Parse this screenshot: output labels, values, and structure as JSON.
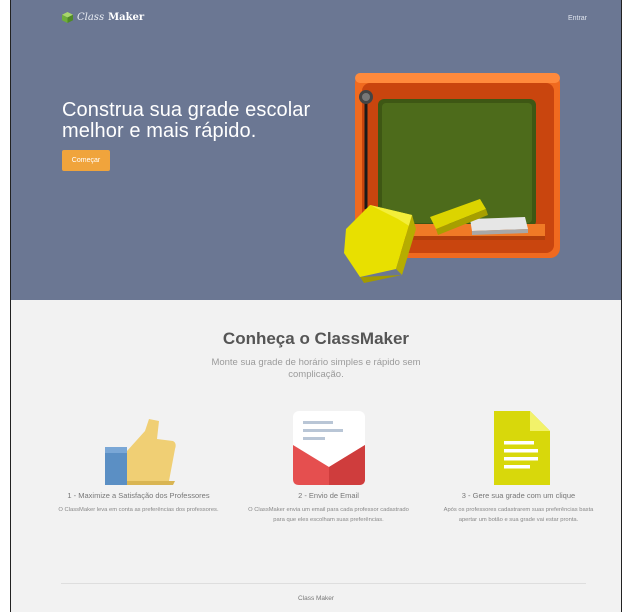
{
  "nav": {
    "brand_italic": "Class",
    "brand_bold": "Maker",
    "login_label": "Entrar"
  },
  "hero": {
    "title": "Construa sua grade escolar melhor e mais rápido.",
    "cta_label": "Começar"
  },
  "intro": {
    "title": "Conheça o ClassMaker",
    "subtitle": "Monte sua grade de horário simples e rápido sem complicação."
  },
  "features": [
    {
      "icon": "thumbs-up-icon",
      "title": "1 - Maximize a Satisfação dos Professores",
      "text": "O ClassMaker leva em conta as preferências dos professores."
    },
    {
      "icon": "envelope-icon",
      "title": "2 - Envio de Email",
      "text": "O ClassMaker envia um email para cada professor cadastrado para que eles escolham suas preferências."
    },
    {
      "icon": "document-icon",
      "title": "3 - Gere sua grade com um clique",
      "text": "Após os professores cadastrarem suas preferências basta apertar um botão e sua grade vai estar pronta."
    }
  ],
  "footer": {
    "text": "Class Maker"
  },
  "colors": {
    "hero_bg": "#6b7793",
    "accent": "#f0a43c",
    "page_bg": "#f2f2f2"
  }
}
